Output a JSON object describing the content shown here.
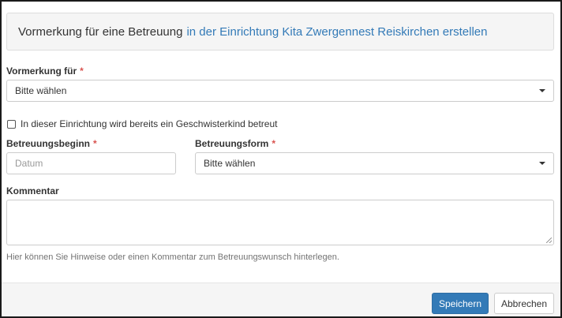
{
  "header": {
    "title_prefix": "Vormerkung für eine Betreuung",
    "title_accent": "in der Einrichtung Kita Zwergennest Reiskirchen erstellen"
  },
  "form": {
    "required_marker": "*",
    "vormerkung": {
      "label": "Vormerkung für",
      "value": "Bitte wählen"
    },
    "sibling_checkbox": {
      "label": "In dieser Einrichtung wird bereits ein Geschwisterkind betreut",
      "checked": false
    },
    "start": {
      "label": "Betreuungsbeginn",
      "placeholder": "Datum",
      "value": ""
    },
    "form_type": {
      "label": "Betreuungsform",
      "value": "Bitte wählen"
    },
    "comment": {
      "label": "Kommentar",
      "value": "",
      "help": "Hier können Sie Hinweise oder einen Kommentar zum Betreuungswunsch hinterlegen."
    }
  },
  "footer": {
    "save_label": "Speichern",
    "cancel_label": "Abbrechen"
  },
  "colors": {
    "accent": "#337ab7",
    "required": "#d9534f",
    "primary_button": "#337ab7"
  }
}
